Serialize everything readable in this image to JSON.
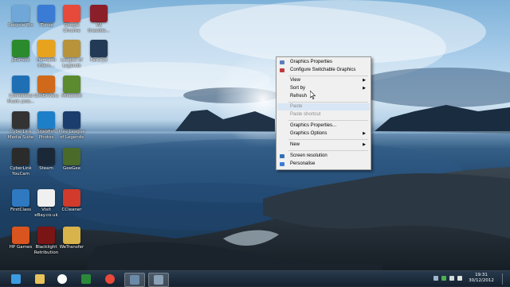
{
  "desktop": {
    "icons": [
      {
        "label": "Recycle Bin",
        "icon": "recycle-bin-icon",
        "color": "#6fa8d8"
      },
      {
        "label": "iTunes",
        "icon": "itunes-icon",
        "color": "#3a7bd5"
      },
      {
        "label": "Google Chrome",
        "icon": "chrome-icon",
        "color": "#e7493b"
      },
      {
        "label": "Wi thesetie...",
        "icon": "app-icon",
        "color": "#8a1f2a"
      },
      {
        "label": "µTorrent",
        "icon": "utorrent-icon",
        "color": "#2b8a2b"
      },
      {
        "label": "Hamachi Intern...",
        "icon": "globe-icon",
        "color": "#e8a31e"
      },
      {
        "label": "League of Legends",
        "icon": "lol-icon",
        "color": "#b8933a"
      },
      {
        "label": "FarCry3",
        "icon": "farcry3-icon",
        "color": "#223a55"
      },
      {
        "label": "Connected Music pow...",
        "icon": "music-icon",
        "color": "#1f6fb5"
      },
      {
        "label": "GimDrivers",
        "icon": "drivers-icon",
        "color": "#d06a1a"
      },
      {
        "label": "Minecraft",
        "icon": "minecraft-icon",
        "color": "#5c8a2e"
      },
      {
        "label": "CyberLink Media Suite",
        "icon": "cyberlink-icon",
        "color": "#333333"
      },
      {
        "label": "Snapfish Photos",
        "icon": "snapfish-icon",
        "color": "#1e7fc9"
      },
      {
        "label": "Play League of Legends",
        "icon": "lol-play-icon",
        "color": "#1a3d6d"
      },
      {
        "label": "CyberLink YouCam",
        "icon": "youcam-icon",
        "color": "#2b2b2b"
      },
      {
        "label": "Steam",
        "icon": "steam-icon",
        "color": "#1b2838"
      },
      {
        "label": "GeeGee",
        "icon": "app-icon",
        "color": "#4a6a2a"
      },
      {
        "label": "FirstClass",
        "icon": "firstclass-icon",
        "color": "#2f79c1"
      },
      {
        "label": "Visit eBay.co.uk",
        "icon": "ebay-icon",
        "color": "#f0f0f0"
      },
      {
        "label": "CCleaner",
        "icon": "ccleaner-icon",
        "color": "#d23a2b"
      },
      {
        "label": "HP Games",
        "icon": "hp-games-icon",
        "color": "#d9541e"
      },
      {
        "label": "Blacklight Retribution",
        "icon": "blacklight-icon",
        "color": "#7a1515"
      },
      {
        "label": "WeTransfer",
        "icon": "folder-icon",
        "color": "#d8b24a"
      }
    ]
  },
  "context_menu": {
    "items": [
      {
        "label": "Graphics Properties",
        "icon_color": "#5a7fbf"
      },
      {
        "label": "Configure Switchable Graphics",
        "icon_color": "#c03a3a"
      },
      {
        "label": "View"
      },
      {
        "label": "Sort by"
      },
      {
        "label": "Refresh"
      },
      {
        "label": "Paste"
      },
      {
        "label": "Paste shortcut"
      },
      {
        "label": "Graphics Properties..."
      },
      {
        "label": "Graphics Options"
      },
      {
        "label": "New"
      },
      {
        "label": "Screen resolution",
        "icon_color": "#2e6fb8"
      },
      {
        "label": "Personalise",
        "icon_color": "#3a7bd5"
      }
    ]
  },
  "taskbar": {
    "pinned": [
      "internet-explorer-icon",
      "file-explorer-icon",
      "hp-icon",
      "store-icon",
      "chrome-icon",
      "window-icon",
      "window-icon"
    ],
    "clock_time": "19:31",
    "clock_date": "30/12/2012"
  }
}
